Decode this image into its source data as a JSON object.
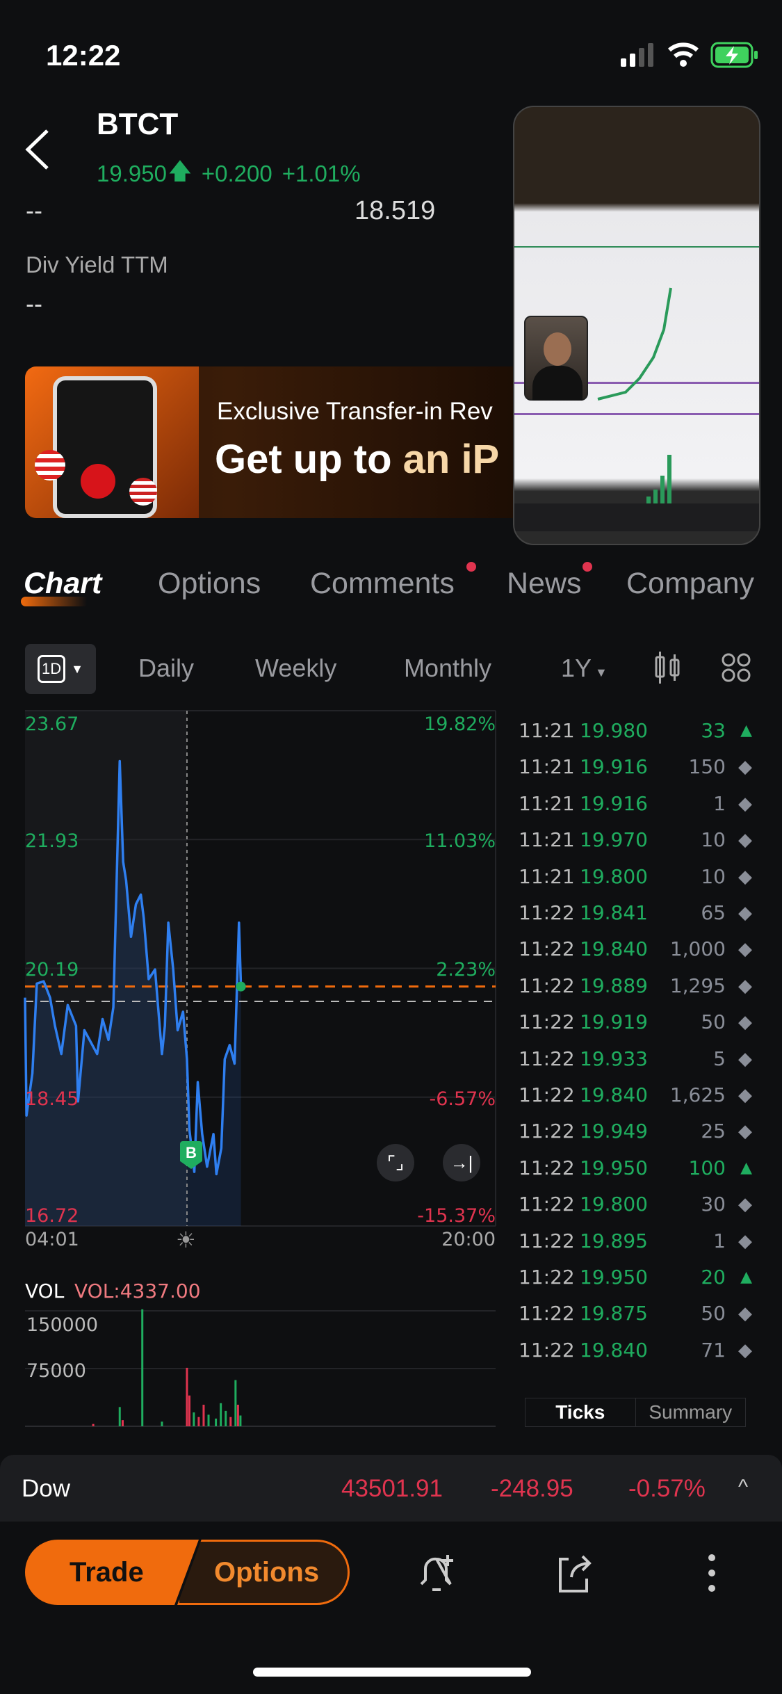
{
  "status_bar": {
    "time": "12:22",
    "icons": [
      "signal-icon",
      "wifi-icon",
      "battery-charging-icon"
    ]
  },
  "header": {
    "symbol": "BTCT",
    "price": "19.950",
    "change": "+0.200",
    "change_pct": "+1.01%",
    "arrow": "up-arrow-icon"
  },
  "stats": {
    "left_value": "--",
    "right_value": "18.519",
    "div_yield_label": "Div Yield TTM",
    "div_yield_value": "--"
  },
  "banner": {
    "line1": "Exclusive Transfer-in Rev",
    "line2_white": "Get up to ",
    "line2_gold": "an iP"
  },
  "tabs": [
    {
      "label": "Chart",
      "active": true
    },
    {
      "label": "Options"
    },
    {
      "label": "Comments",
      "dot": true
    },
    {
      "label": "News",
      "dot": true
    },
    {
      "label": "Company"
    }
  ],
  "toolbar": {
    "interval": "1D",
    "items": [
      "Daily",
      "Weekly",
      "Monthly"
    ],
    "range": "1Y"
  },
  "colors": {
    "green": "#1fad5f",
    "red": "#e0344f",
    "orange": "#f06b0d",
    "line": "#2f7ff0"
  },
  "chart_data": {
    "type": "line",
    "y_left_ticks": [
      "23.67",
      "21.93",
      "20.19",
      "18.45",
      "16.72"
    ],
    "y_right_ticks": [
      "19.82%",
      "11.03%",
      "2.23%",
      "-6.57%",
      "-15.37%"
    ],
    "x_ticks": [
      "04:01",
      "20:00"
    ],
    "ylim": [
      16.72,
      23.67
    ],
    "xlim": [
      "04:01",
      "20:00"
    ],
    "current_price": 19.95,
    "prev_close": 19.75,
    "market_open": "09:31",
    "buy_marker": {
      "label": "B",
      "time": "09:31"
    },
    "points": [
      [
        "04:01",
        19.8
      ],
      [
        "04:04",
        18.21
      ],
      [
        "04:16",
        18.78
      ],
      [
        "04:25",
        19.99
      ],
      [
        "04:39",
        20.02
      ],
      [
        "04:52",
        19.8
      ],
      [
        "05:02",
        19.42
      ],
      [
        "05:15",
        19.04
      ],
      [
        "05:28",
        19.7
      ],
      [
        "05:45",
        19.42
      ],
      [
        "05:49",
        18.4
      ],
      [
        "06:02",
        19.36
      ],
      [
        "06:28",
        19.04
      ],
      [
        "06:39",
        19.51
      ],
      [
        "06:51",
        19.23
      ],
      [
        "07:01",
        19.67
      ],
      [
        "07:07",
        21.19
      ],
      [
        "07:14",
        22.99
      ],
      [
        "07:21",
        21.63
      ],
      [
        "07:27",
        21.38
      ],
      [
        "07:37",
        20.62
      ],
      [
        "07:47",
        21.06
      ],
      [
        "07:57",
        21.19
      ],
      [
        "08:03",
        20.87
      ],
      [
        "08:13",
        20.05
      ],
      [
        "08:26",
        20.18
      ],
      [
        "08:40",
        19.04
      ],
      [
        "08:46",
        19.42
      ],
      [
        "08:53",
        20.81
      ],
      [
        "09:03",
        20.18
      ],
      [
        "09:12",
        19.36
      ],
      [
        "09:23",
        19.61
      ],
      [
        "09:31",
        18.97
      ],
      [
        "09:36",
        18.02
      ],
      [
        "09:46",
        17.45
      ],
      [
        "09:53",
        18.66
      ],
      [
        "10:02",
        17.96
      ],
      [
        "10:12",
        17.52
      ],
      [
        "10:25",
        17.96
      ],
      [
        "10:31",
        17.42
      ],
      [
        "10:41",
        17.77
      ],
      [
        "10:48",
        18.97
      ],
      [
        "10:58",
        19.16
      ],
      [
        "11:08",
        18.91
      ],
      [
        "11:17",
        20.81
      ],
      [
        "11:21",
        19.95
      ]
    ],
    "volume": {
      "label": "VOL",
      "value_label": "VOL:4337.00",
      "ticks": [
        "150000",
        "75000"
      ],
      "ylim": [
        0,
        150000
      ],
      "bars": [
        [
          "06:20",
          3000,
          "red"
        ],
        [
          "07:14",
          25000,
          "green"
        ],
        [
          "07:20",
          8000,
          "red"
        ],
        [
          "08:00",
          152000,
          "green"
        ],
        [
          "08:40",
          6000,
          "green"
        ],
        [
          "09:31",
          76000,
          "red"
        ],
        [
          "09:36",
          40000,
          "red"
        ],
        [
          "09:45",
          18000,
          "green"
        ],
        [
          "09:55",
          12000,
          "red"
        ],
        [
          "10:05",
          28000,
          "red"
        ],
        [
          "10:15",
          15000,
          "green"
        ],
        [
          "10:30",
          10000,
          "green"
        ],
        [
          "10:40",
          30000,
          "green"
        ],
        [
          "10:50",
          20000,
          "green"
        ],
        [
          "11:00",
          12000,
          "red"
        ],
        [
          "11:10",
          60000,
          "green"
        ],
        [
          "11:15",
          28000,
          "red"
        ],
        [
          "11:20",
          14000,
          "green"
        ]
      ]
    }
  },
  "ticks": [
    [
      "11:21",
      "19.980",
      "33",
      "up"
    ],
    [
      "11:21",
      "19.916",
      "150",
      "neutral"
    ],
    [
      "11:21",
      "19.916",
      "1",
      "neutral"
    ],
    [
      "11:21",
      "19.970",
      "10",
      "neutral"
    ],
    [
      "11:21",
      "19.800",
      "10",
      "neutral"
    ],
    [
      "11:22",
      "19.841",
      "65",
      "neutral"
    ],
    [
      "11:22",
      "19.840",
      "1,000",
      "neutral"
    ],
    [
      "11:22",
      "19.889",
      "1,295",
      "neutral"
    ],
    [
      "11:22",
      "19.919",
      "50",
      "neutral"
    ],
    [
      "11:22",
      "19.933",
      "5",
      "neutral"
    ],
    [
      "11:22",
      "19.840",
      "1,625",
      "neutral"
    ],
    [
      "11:22",
      "19.949",
      "25",
      "neutral"
    ],
    [
      "11:22",
      "19.950",
      "100",
      "up"
    ],
    [
      "11:22",
      "19.800",
      "30",
      "neutral"
    ],
    [
      "11:22",
      "19.895",
      "1",
      "neutral"
    ],
    [
      "11:22",
      "19.950",
      "20",
      "up"
    ],
    [
      "11:22",
      "19.875",
      "50",
      "neutral"
    ],
    [
      "11:22",
      "19.840",
      "71",
      "neutral"
    ]
  ],
  "ticks_tabs": [
    "Ticks",
    "Summary"
  ],
  "index_bar": {
    "name": "Dow",
    "value": "43501.91",
    "change": "-248.95",
    "change_pct": "-0.57%"
  },
  "bottom": {
    "trade": "Trade",
    "options": "Options"
  }
}
